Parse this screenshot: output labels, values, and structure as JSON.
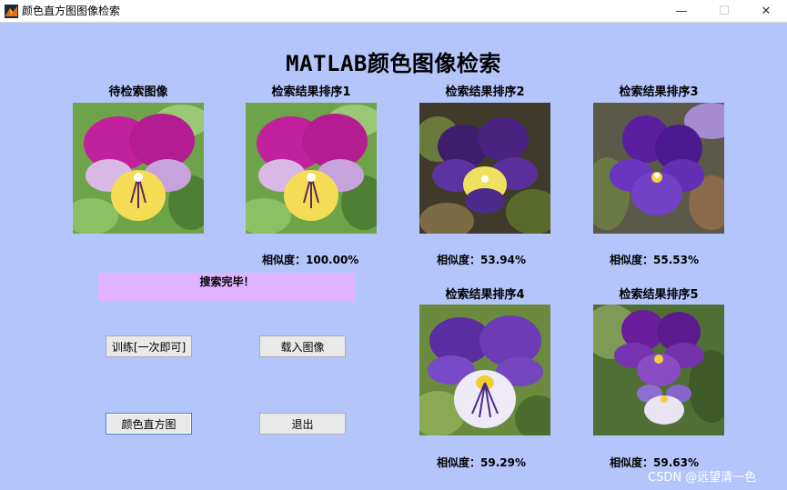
{
  "window": {
    "title": "颜色直方图图像检索",
    "minimize": "—",
    "maximize": "☐",
    "close": "✕"
  },
  "main_title": "MATLAB颜色图像检索",
  "query": {
    "label": "待检索图像"
  },
  "results": [
    {
      "label": "检索结果排序1",
      "similarity": "相似度：100.00%"
    },
    {
      "label": "检索结果排序2",
      "similarity": "相似度：53.94%"
    },
    {
      "label": "检索结果排序3",
      "similarity": "相似度：55.53%"
    },
    {
      "label": "检索结果排序4",
      "similarity": "相似度：59.29%"
    },
    {
      "label": "检索结果排序5",
      "similarity": "相似度：59.63%"
    }
  ],
  "status_text": "搜索完毕！",
  "buttons": {
    "train": "训练[一次即可]",
    "load": "载入图像",
    "histogram": "颜色直方图",
    "exit": "退出"
  },
  "watermark": "CSDN @远望清一色",
  "colors": {
    "background": "#b3c5fb",
    "status_bg": "#e0b3ff"
  }
}
